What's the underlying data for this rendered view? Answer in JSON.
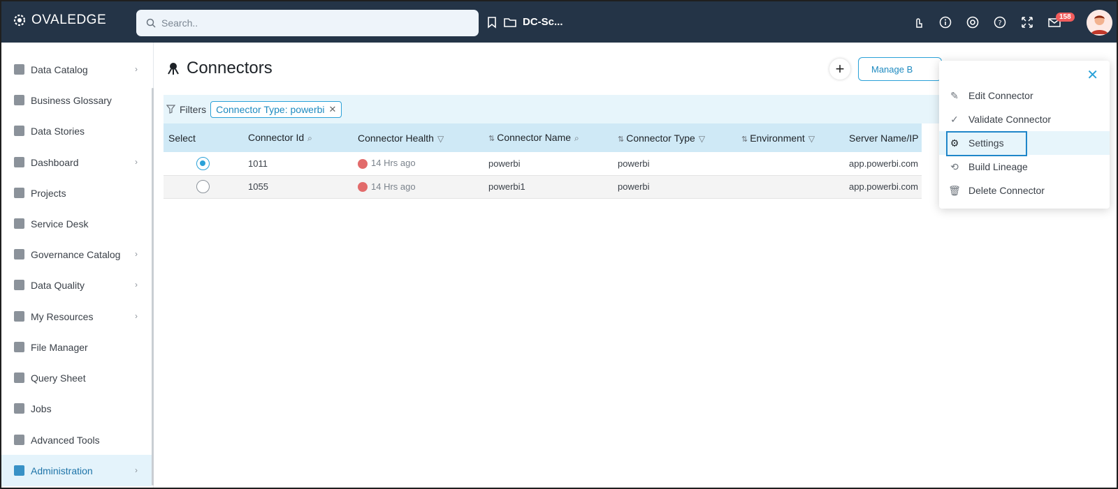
{
  "app": {
    "logo_text": "OVALEDGE"
  },
  "search": {
    "placeholder": "Search.."
  },
  "header": {
    "workspace_label": "DC-Sc...",
    "notifications_count": "158"
  },
  "sidebar": {
    "items": [
      {
        "label": "Data Catalog",
        "has_chevron": true,
        "icon": "data-catalog-icon"
      },
      {
        "label": "Business Glossary",
        "has_chevron": false,
        "icon": "book-icon"
      },
      {
        "label": "Data Stories",
        "has_chevron": false,
        "icon": "open-book-icon"
      },
      {
        "label": "Dashboard",
        "has_chevron": true,
        "icon": "dashboard-icon"
      },
      {
        "label": "Projects",
        "has_chevron": false,
        "icon": "projects-icon"
      },
      {
        "label": "Service Desk",
        "has_chevron": false,
        "icon": "service-desk-icon"
      },
      {
        "label": "Governance Catalog",
        "has_chevron": true,
        "icon": "bank-icon"
      },
      {
        "label": "Data Quality",
        "has_chevron": true,
        "icon": "data-quality-icon"
      },
      {
        "label": "My Resources",
        "has_chevron": true,
        "icon": "resources-icon"
      },
      {
        "label": "File Manager",
        "has_chevron": false,
        "icon": "folder-icon"
      },
      {
        "label": "Query Sheet",
        "has_chevron": false,
        "icon": "code-sheet-icon"
      },
      {
        "label": "Jobs",
        "has_chevron": false,
        "icon": "jobs-icon"
      },
      {
        "label": "Advanced Tools",
        "has_chevron": false,
        "icon": "tools-icon"
      },
      {
        "label": "Administration",
        "has_chevron": true,
        "icon": "admin-icon",
        "active": true
      }
    ]
  },
  "page": {
    "title": "Connectors",
    "manage_button": "Manage B"
  },
  "filters": {
    "label": "Filters",
    "chip_key": "Connector Type",
    "chip_value": ": powerbi"
  },
  "table": {
    "headers": [
      "Select",
      "Connector Id",
      "Connector Health",
      "Connector Name",
      "Connector Type",
      "Environment",
      "Server Name/IP"
    ],
    "rows": [
      {
        "selected": true,
        "id": "1011",
        "health": "14 Hrs ago",
        "name": "powerbi",
        "type": "powerbi",
        "environment": "",
        "server": "app.powerbi.com"
      },
      {
        "selected": false,
        "id": "1055",
        "health": "14 Hrs ago",
        "name": "powerbi1",
        "type": "powerbi",
        "environment": "",
        "server": "app.powerbi.com"
      }
    ]
  },
  "context_menu": {
    "items": [
      "Edit Connector",
      "Validate Connector",
      "Settings",
      "Build Lineage",
      "Delete Connector"
    ],
    "highlighted": "Settings"
  },
  "colors": {
    "topbar": "#243447",
    "accent": "#2aa1d8",
    "health_bad": "#e26b6b",
    "header_row": "#cfe9f6"
  }
}
